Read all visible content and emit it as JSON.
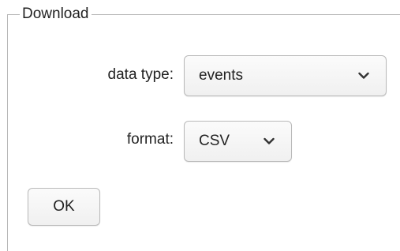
{
  "fieldset": {
    "legend": "Download"
  },
  "form": {
    "data_type": {
      "label": "data type:",
      "value": "events",
      "icon": "chevron-down-icon"
    },
    "format": {
      "label": "format:",
      "value": "CSV",
      "icon": "chevron-down-icon"
    },
    "ok_label": "OK"
  }
}
